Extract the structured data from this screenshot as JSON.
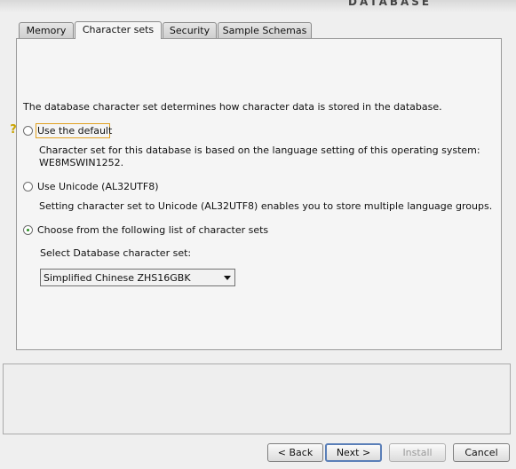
{
  "header": {
    "brand": "DATABASE"
  },
  "tabs": [
    {
      "label": "Memory"
    },
    {
      "label": "Character sets"
    },
    {
      "label": "Security"
    },
    {
      "label": "Sample Schemas"
    }
  ],
  "content": {
    "description": "The database character set determines how character data is stored in the database.",
    "option_default": {
      "label": "Use the default",
      "desc_line1": "Character set for this database is based on the language setting of this operating system:",
      "desc_line2": "WE8MSWIN1252."
    },
    "option_unicode": {
      "label": "Use Unicode (AL32UTF8)",
      "desc": "Setting character set to Unicode (AL32UTF8) enables you to store multiple language groups."
    },
    "option_choose": {
      "label": "Choose from the following list of character sets"
    },
    "select_label": "Select Database character set:",
    "select_value": "Simplified Chinese ZHS16GBK"
  },
  "buttons": {
    "back": "< Back",
    "next": "Next >",
    "install": "Install",
    "cancel": "Cancel"
  }
}
